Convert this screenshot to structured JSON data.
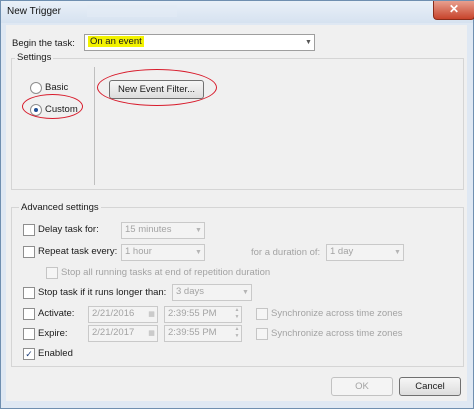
{
  "window": {
    "title": "New Trigger",
    "close_glyph": "✕"
  },
  "begin": {
    "label": "Begin the task:",
    "value": "On an event"
  },
  "settings": {
    "group_label": "Settings",
    "basic_label": "Basic",
    "custom_label": "Custom",
    "selected": "custom",
    "new_filter_button": "New Event Filter..."
  },
  "advanced": {
    "group_label": "Advanced settings",
    "delay_label": "Delay task for:",
    "delay_value": "15 minutes",
    "repeat_label": "Repeat task every:",
    "repeat_value": "1 hour",
    "duration_label": "for a duration of:",
    "duration_value": "1 day",
    "stop_running_label": "Stop all running tasks at end of repetition duration",
    "stop_longer_label": "Stop task if it runs longer than:",
    "stop_longer_value": "3 days",
    "activate_label": "Activate:",
    "activate_date": "2/21/2016",
    "activate_time": "2:39:55 PM",
    "expire_label": "Expire:",
    "expire_date": "2/21/2017",
    "expire_time": "2:39:55 PM",
    "sync_label": "Synchronize across time zones",
    "enabled_label": "Enabled",
    "enabled_checked": true
  },
  "footer": {
    "ok_label": "OK",
    "cancel_label": "Cancel"
  }
}
